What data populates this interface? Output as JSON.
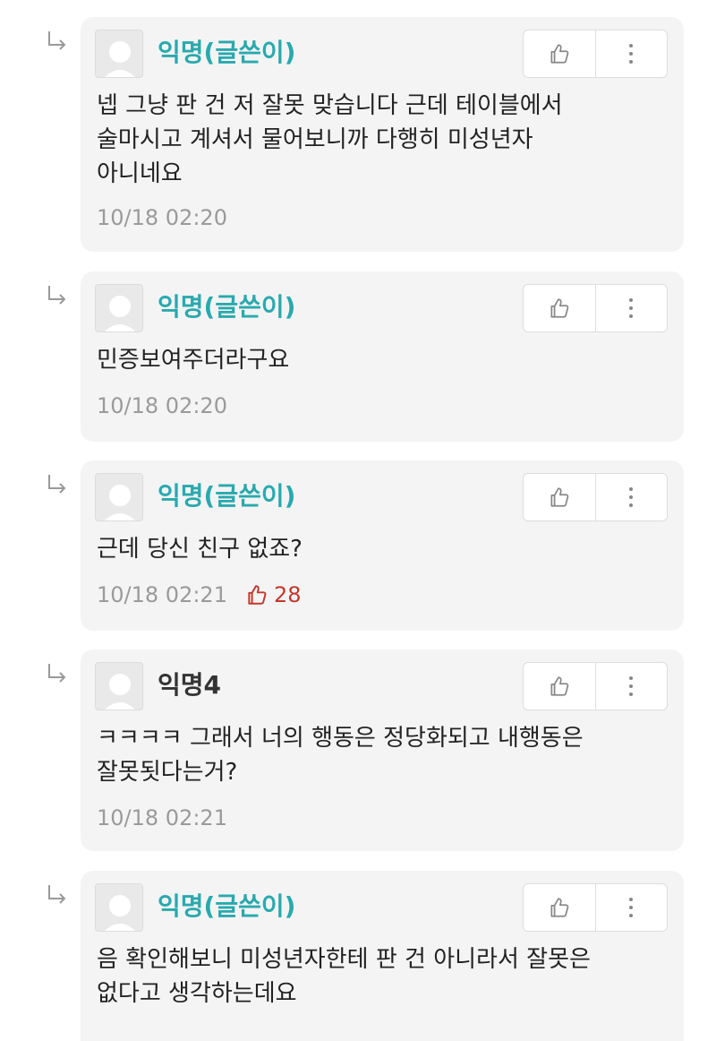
{
  "comments": [
    {
      "author": "익명(글쓴이)",
      "content": "넵 그냥 판 건 저 잘못 맞습니다 근데 테이블에서\n술마시고 계셔서 물어보니까 다행히 미성년자\n아니네요",
      "time": "10/18 02:20",
      "likes": ""
    },
    {
      "author": "익명(글쓴이)",
      "content": "민증보여주더라구요",
      "time": "10/18 02:20",
      "likes": ""
    },
    {
      "author": "익명(글쓴이)",
      "content": "근데 당신 친구 없죠?",
      "time": "10/18 02:21",
      "likes": "28"
    },
    {
      "author": "익명4",
      "content": "ㅋㅋㅋㅋ 그래서 너의 행동은 정당화되고 내행동은\n잘못됫다는거?",
      "time": "10/18 02:21",
      "likes": ""
    },
    {
      "author": "익명(글쓴이)",
      "content": "음 확인해보니 미성년자한테 판 건 아니라서 잘못은\n없다고 생각하는데요",
      "time": "",
      "likes": ""
    }
  ],
  "colors": {
    "op_author": "#2aa9ad",
    "author": "#333333",
    "like_highlight": "#c0392b",
    "card_bg": "#f4f4f5"
  },
  "icons": {
    "reply": "reply-arrow-icon",
    "like": "thumbs-up-icon",
    "more": "more-vertical-icon",
    "avatar": "default-avatar-icon"
  }
}
